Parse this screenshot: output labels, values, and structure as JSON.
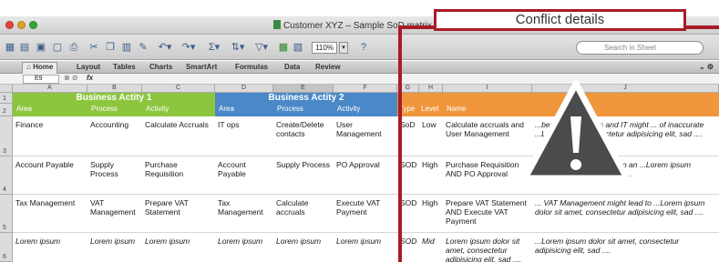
{
  "window": {
    "title": "Customer XYZ – Sample SoD matrix extract .xlsx"
  },
  "toolbar": {
    "zoom": "110%",
    "search_placeholder": "Search in Sheet"
  },
  "ribbon": {
    "tabs": [
      "Home",
      "Layout",
      "Tables",
      "Charts",
      "SmartArt",
      "Formulas",
      "Data",
      "Review"
    ],
    "active_tab": "Home"
  },
  "formula_bar": {
    "cell_ref": "E9",
    "fx_label": "fx"
  },
  "sheet": {
    "columns": [
      "A",
      "B",
      "C",
      "D",
      "E",
      "F",
      "G",
      "H",
      "I",
      "J"
    ],
    "rows": [
      "1",
      "2",
      "3",
      "4",
      "5",
      "6"
    ],
    "group1": "Business Actity 1",
    "group2": "Business Actity 2",
    "subheaders": [
      "Area",
      "Process",
      "Activity",
      "Area",
      "Process",
      "Activity",
      "Type",
      "Level",
      "Name",
      ""
    ],
    "data": [
      [
        "Finance",
        "Accounting",
        "Calculate Accruals",
        "IT ops",
        "Create/Delete contacts",
        "User Management",
        "SoD",
        "Low",
        "Calculate accruals and User Management",
        "...between business and IT might ... of inaccurate ...Lorem ipsum ... sectetur adipisicing elit, sad ...."
      ],
      [
        "Account Payable",
        "Supply Process",
        "Purchase Requisition",
        "Account Payable",
        "Supply Process",
        "PO Approval",
        "SOD",
        "High",
        "Purchase Requisition AND PO Approval",
        "...anagement might lead to an ...Lorem ipsum dolor sit amet, ... elit, sad ...."
      ],
      [
        "Tax Management",
        "VAT Management",
        "Prepare VAT Statement",
        "Tax Management",
        "Calculate accruals",
        "Execute VAT Payment",
        "SOD",
        "High",
        "Prepare VAT Statement AND Execute VAT Payment",
        "... VAT Management might lead to ...Lorem ipsum dolor sit amet, consectetur adipisicing elit, sad ...."
      ],
      [
        "Lorem ipsum",
        "Lorem ipsum",
        "Lorem ipsum",
        "Lorem ipsum",
        "Lorem ipsum",
        "Lorem ipsum",
        "SOD",
        "Mid",
        "Lorem ipsum dolor sit amet, consectetur adipisicing elit, sad ....",
        "...Lorem ipsum dolor sit amet, consectetur adipisicing elit, sad ...."
      ]
    ]
  },
  "overlay": {
    "label": "Conflict details",
    "frame_color": "#a81c28",
    "icon": "warning-icon"
  },
  "colors": {
    "group1": "#8cc63f",
    "group2": "#4a88c8",
    "conflict": "#f0963c"
  }
}
